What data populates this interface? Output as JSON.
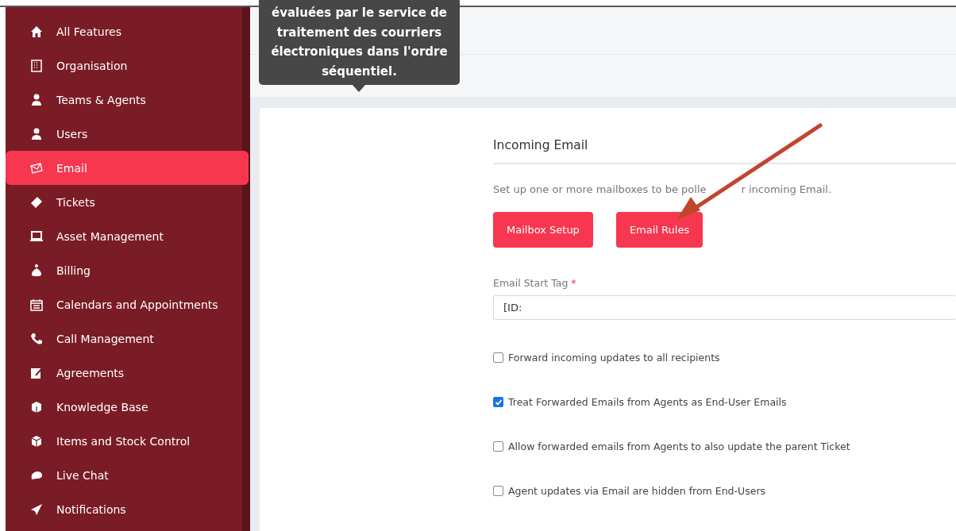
{
  "sidebar": {
    "items": [
      {
        "label": "All Features",
        "selected": false
      },
      {
        "label": "Organisation",
        "selected": false
      },
      {
        "label": "Teams & Agents",
        "selected": false
      },
      {
        "label": "Users",
        "selected": false
      },
      {
        "label": "Email",
        "selected": true
      },
      {
        "label": "Tickets",
        "selected": false
      },
      {
        "label": "Asset Management",
        "selected": false
      },
      {
        "label": "Billing",
        "selected": false
      },
      {
        "label": "Calendars and Appointments",
        "selected": false
      },
      {
        "label": "Call Management",
        "selected": false
      },
      {
        "label": "Agreements",
        "selected": false
      },
      {
        "label": "Knowledge Base",
        "selected": false
      },
      {
        "label": "Items and Stock Control",
        "selected": false
      },
      {
        "label": "Live Chat",
        "selected": false
      },
      {
        "label": "Notifications",
        "selected": false
      }
    ]
  },
  "tooltip": {
    "lines": [
      "évaluées par le service de",
      "traitement des courriers",
      "électroniques dans l'ordre",
      "séquentiel."
    ]
  },
  "form": {
    "title": "Incoming Email",
    "description": [
      "Set up one or more mailboxes to be polle",
      "r incoming Email."
    ],
    "buttons": [
      "Mailbox Setup",
      "Email Rules"
    ],
    "start_tag": {
      "label": "Email Start Tag",
      "required_mark": "*",
      "value": "[ID:"
    },
    "options": [
      {
        "label": "Forward incoming updates to all recipients",
        "checked": false
      },
      {
        "label": "Treat Forwarded Emails from Agents as End-User Emails",
        "checked": true
      },
      {
        "label": "Allow forwarded emails from Agents to also update the parent Ticket",
        "checked": false
      },
      {
        "label": "Agent updates via Email are hidden from End-Users",
        "checked": false
      }
    ]
  }
}
